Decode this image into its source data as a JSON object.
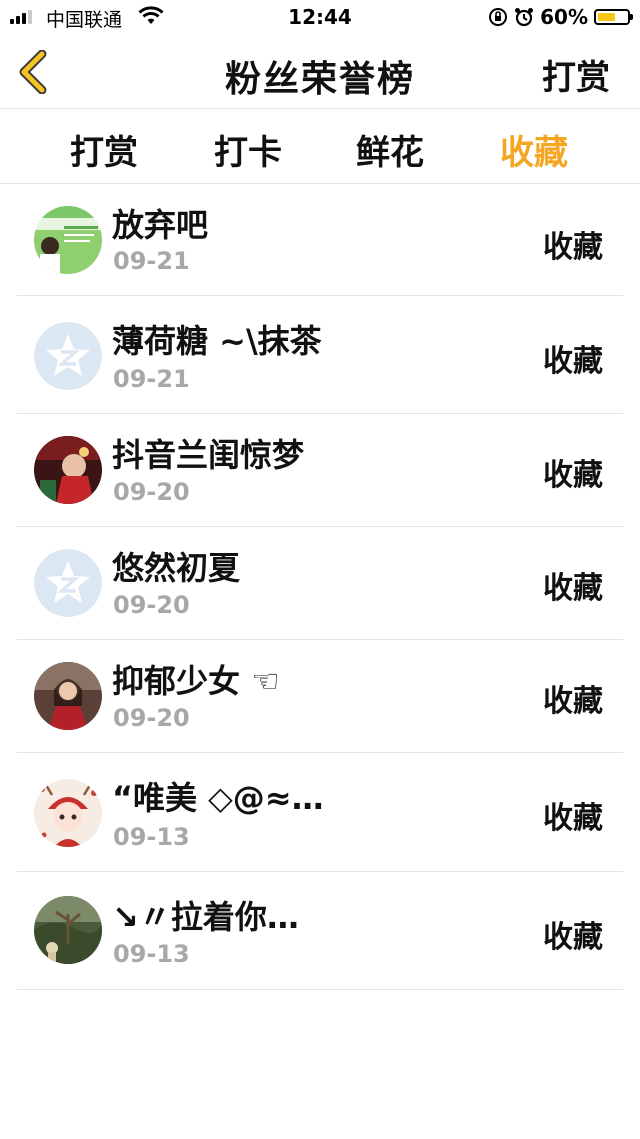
{
  "status_bar": {
    "carrier": "中国联通",
    "time": "12:44",
    "battery": "60%",
    "battery_level": 0.6
  },
  "navbar": {
    "title": "粉丝荣誉榜",
    "right_button": "打赏"
  },
  "tabs": [
    {
      "label": "打赏",
      "active": false
    },
    {
      "label": "打卡",
      "active": false
    },
    {
      "label": "鲜花",
      "active": false
    },
    {
      "label": "收藏",
      "active": true
    }
  ],
  "colors": {
    "accent": "#f5a623",
    "date_gray": "#a8a8a8",
    "divider": "#e3e3e3"
  },
  "list": [
    {
      "name": "放弃吧",
      "date": "09-21",
      "action": "收藏",
      "avatar": "green-photo-avatar"
    },
    {
      "name": "薄荷糖 ~\\抹茶",
      "date": "09-21",
      "action": "收藏",
      "avatar": "default-qq-avatar"
    },
    {
      "name": "抖音兰闺惊梦",
      "date": "09-20",
      "action": "收藏",
      "avatar": "red-photo-avatar"
    },
    {
      "name": "悠然初夏",
      "date": "09-20",
      "action": "收藏",
      "avatar": "default-qq-avatar"
    },
    {
      "name": "抑郁少女 ☜",
      "date": "09-20",
      "action": "收藏",
      "avatar": "girl-photo-avatar"
    },
    {
      "name": "“唯美 ◇@≈…",
      "date": "09-13",
      "action": "收藏",
      "avatar": "cartoon-avatar"
    },
    {
      "name": "↘〃拉着你…",
      "date": "09-13",
      "action": "收藏",
      "avatar": "scenery-avatar"
    }
  ]
}
